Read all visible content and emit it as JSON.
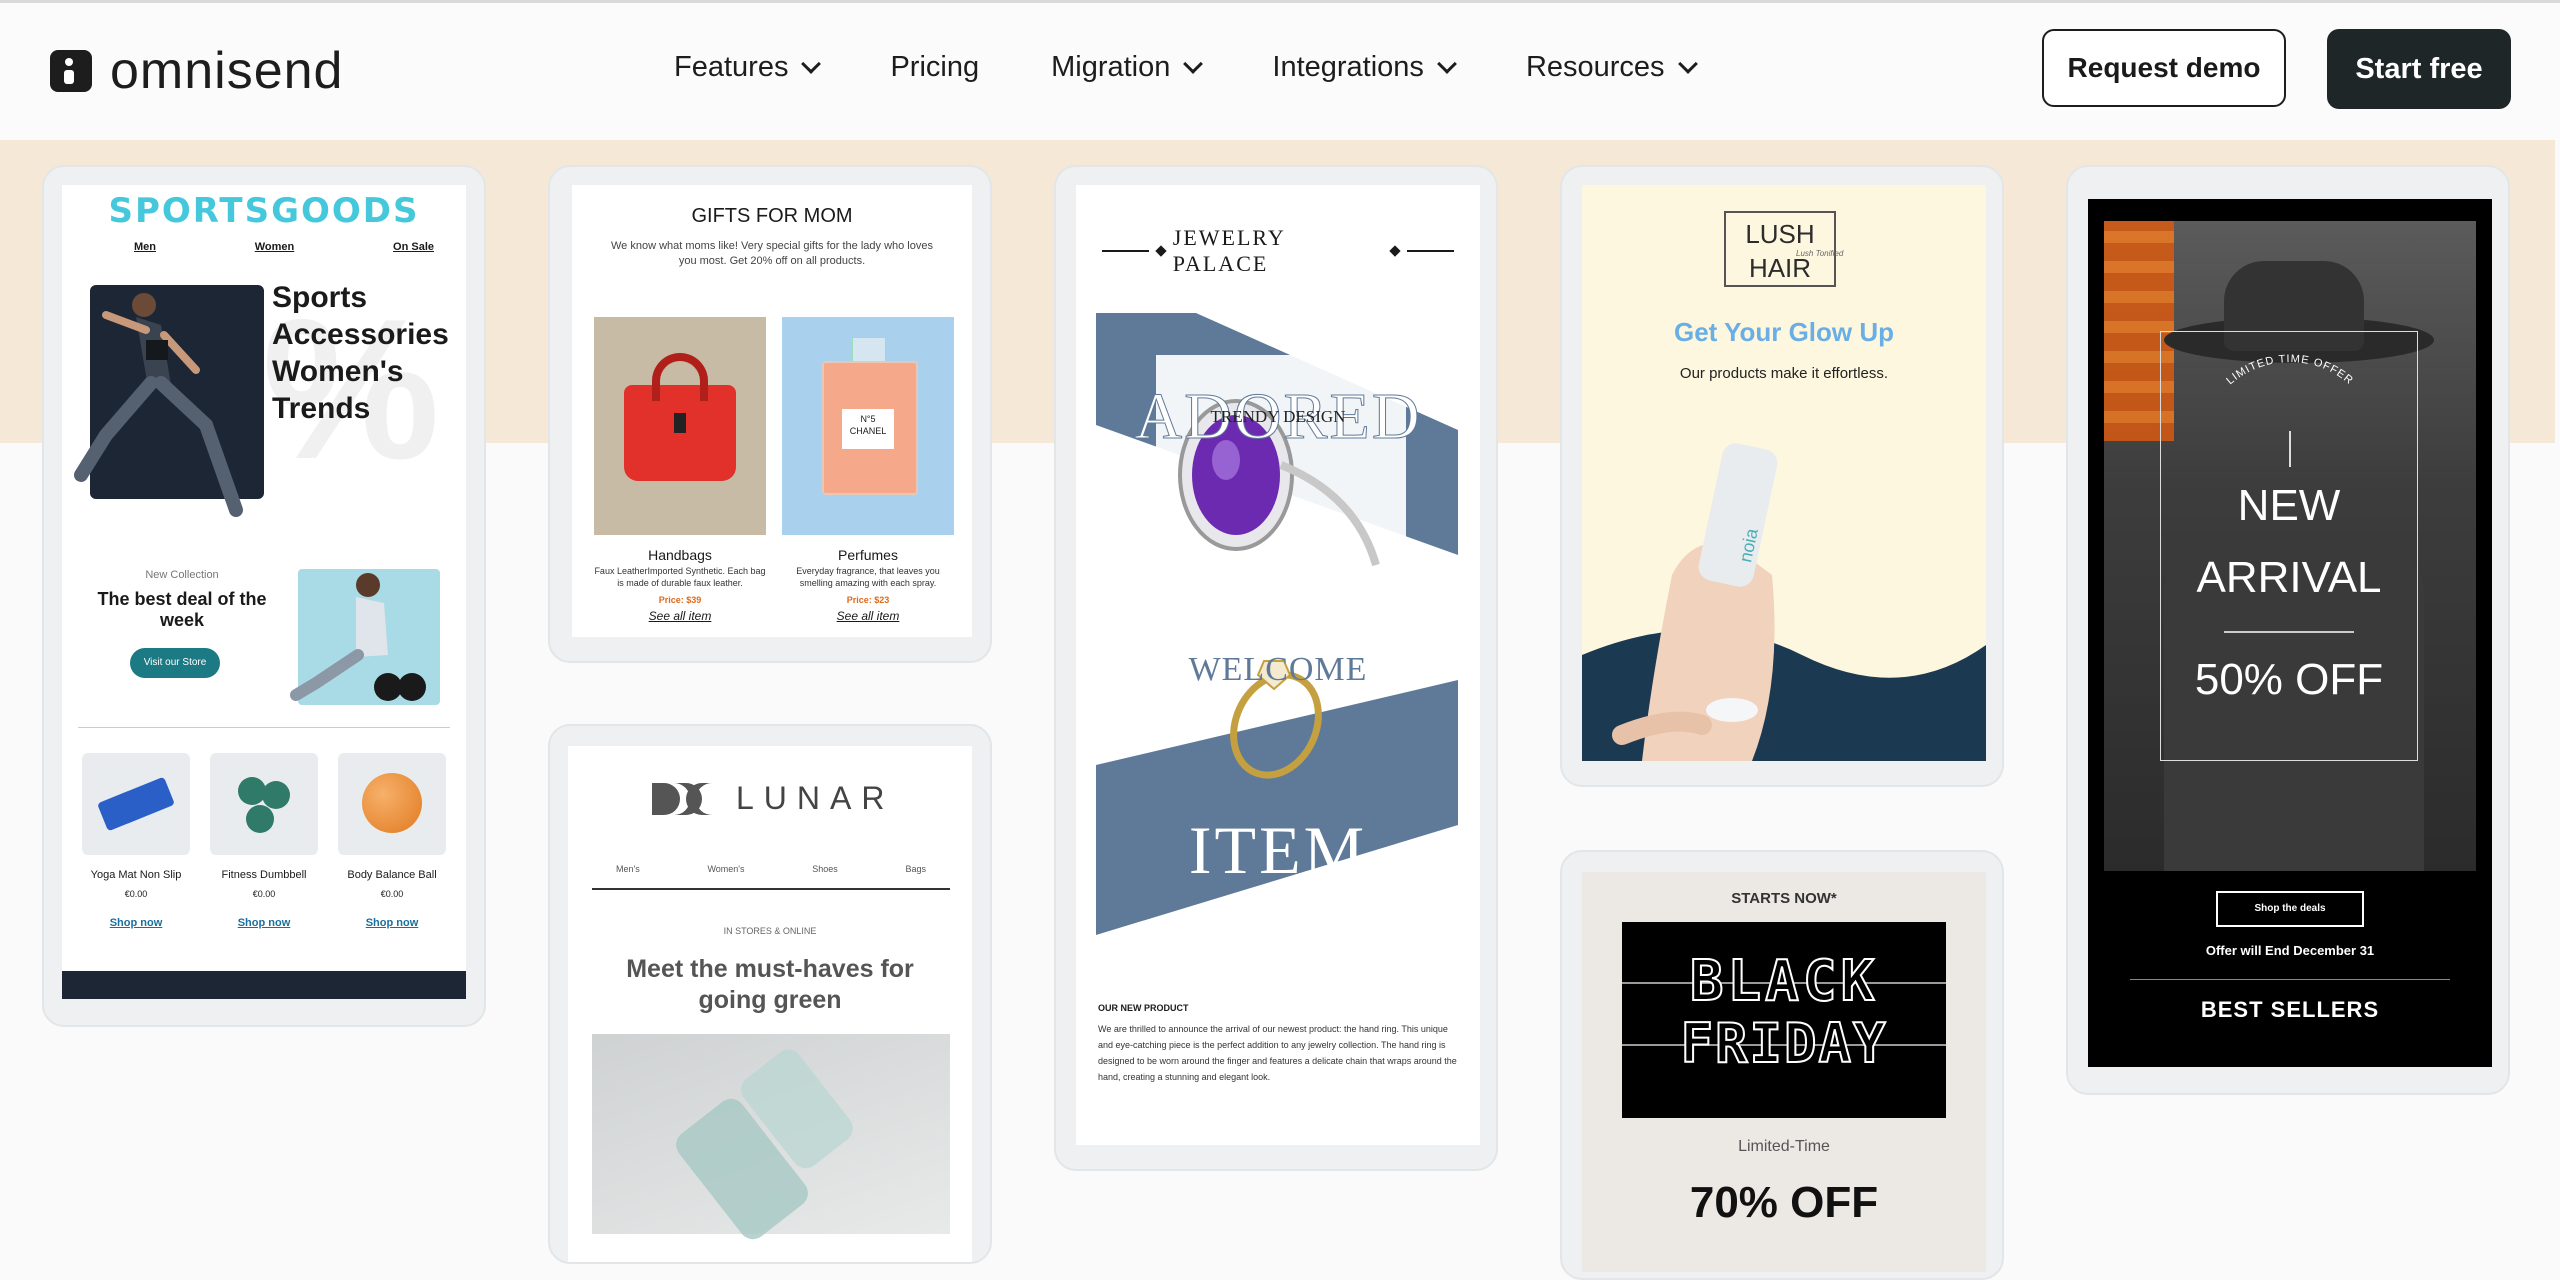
{
  "header": {
    "brand": "omnisend",
    "nav": [
      {
        "label": "Features",
        "dropdown": true
      },
      {
        "label": "Pricing",
        "dropdown": false
      },
      {
        "label": "Migration",
        "dropdown": true
      },
      {
        "label": "Integrations",
        "dropdown": true
      },
      {
        "label": "Resources",
        "dropdown": true
      }
    ],
    "request_demo": "Request demo",
    "start_free": "Start free"
  },
  "colors": {
    "accent_dark": "#1f2628",
    "beige_band": "#f6e8d6",
    "sports_cyan": "#45c8dc",
    "jewelry_blue": "#5f7a99",
    "glow_blue": "#6aaee6",
    "navy": "#1b3a52"
  },
  "sportsgoods": {
    "brand": "SPORTSGOODS",
    "nav": [
      "Men",
      "Women",
      "On Sale"
    ],
    "headline": [
      "Sports",
      "Accessories",
      "Women's",
      "Trends"
    ],
    "collection_label": "New Collection",
    "deal_title": "The best deal of the week",
    "cta": "Visit our Store",
    "products": [
      {
        "name": "Yoga Mat Non Slip",
        "price": "€0.00",
        "link": "Shop now"
      },
      {
        "name": "Fitness Dumbbell",
        "price": "€0.00",
        "link": "Shop now"
      },
      {
        "name": "Body Balance Ball",
        "price": "€0.00",
        "link": "Shop now"
      }
    ]
  },
  "gifts": {
    "title": "GIFTS FOR MOM",
    "intro": "We know what moms like! Very special gifts for the lady who loves you most.  Get 20% off on all products.",
    "items": [
      {
        "name": "Handbags",
        "desc": "Faux LeatherImported Synthetic. Each bag is made of durable faux leather.",
        "price": "Price: $39",
        "link": "See all item"
      },
      {
        "name": "Perfumes",
        "desc": "Everyday fragrance, that leaves you smelling amazing with each spray.",
        "price": "Price: $23",
        "link": "See all item"
      }
    ],
    "perfume_label": "N°5\nCHANEL"
  },
  "lunar": {
    "brand": "LUNAR",
    "nav": [
      "Men's",
      "Women's",
      "Shoes",
      "Bags"
    ],
    "kicker": "IN STORES & ONLINE",
    "headline": "Meet the must-haves for going green"
  },
  "jewelry": {
    "brand": "JEWELRY PALACE",
    "word1": "ADORED",
    "overlay": "TRENDY DESIGN",
    "word2": "WELCOME",
    "word3": "ITEM",
    "section": "OUR NEW PRODUCT",
    "body": "We are thrilled to announce the arrival of our newest product: the hand ring. This unique and eye-catching piece is the perfect addition to any jewelry collection. The hand ring is designed to be worn around the finger and features a delicate chain that wraps around the hand, creating a stunning and elegant look."
  },
  "lush": {
    "brand_line1": "LUSH",
    "brand_line2": "HAIR",
    "script": "Lush Tonified",
    "headline": "Get Your Glow Up",
    "sub": "Our products make it effortless.",
    "bottle": "noia"
  },
  "blackfriday": {
    "kicker": "STARTS NOW*",
    "line1": "BLACK",
    "line2": "FRIDAY",
    "limited": "Limited-Time",
    "offer": "70% OFF"
  },
  "arrival": {
    "badge": "LIMITED TIME OFFER",
    "line1": "NEW",
    "line2": "ARRIVAL",
    "discount": "50% OFF",
    "cta": "Shop the deals",
    "ends": "Offer will End December 31",
    "section": "BEST SELLERS"
  }
}
